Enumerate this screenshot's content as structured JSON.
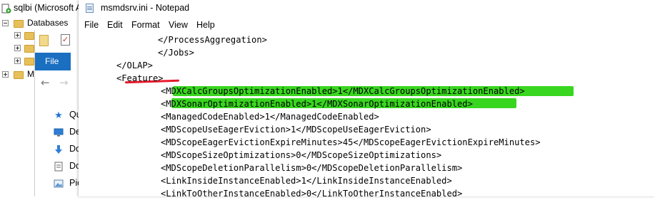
{
  "ssms": {
    "title": "sqlbi (Microsoft A",
    "tree": [
      {
        "label": "Databases",
        "expander": "minus"
      },
      {
        "label": "",
        "expander": "plus"
      },
      {
        "label": "",
        "expander": "plus"
      },
      {
        "label": "",
        "expander": "plus"
      },
      {
        "label": "M",
        "expander": "plus"
      }
    ]
  },
  "explorer": {
    "file_tab": "File",
    "back_arrow": "←",
    "forward_arrow": "→",
    "sidebar": [
      {
        "label": "Quic",
        "icon": "star-icon"
      },
      {
        "label": "De",
        "icon": "desktop-icon"
      },
      {
        "label": "Do",
        "icon": "download-icon"
      },
      {
        "label": "Do",
        "icon": "documents-icon"
      },
      {
        "label": "Pic",
        "icon": "pictures-icon"
      }
    ]
  },
  "notepad": {
    "title": "msmdsrv.ini - Notepad",
    "menu": [
      "File",
      "Edit",
      "Format",
      "View",
      "Help"
    ],
    "lines": [
      "    </ProcessAggregation>",
      "  </Jobs>",
      "</OLAP>",
      "<Feature>",
      "  <MDXCalcGroupsOptimizationEnabled>1</MDXCalcGroupsOptimizationEnabled>",
      "  <MDXSonarOptimizationEnabled>1</MDXSonarOptimizationEnabled>",
      "  <ManagedCodeEnabled>1</ManagedCodeEnabled>",
      "  <MDScopeUseEagerEviction>1</MDScopeUseEagerEviction>",
      "  <MDScopeEagerEvictionExpireMinutes>45</MDScopeEagerEvictionExpireMinutes>",
      "  <MDScopeSizeOptimizations>0</MDScopeSizeOptimizations>",
      "  <MDScopeDeletionParallelism>0</MDScopeDeletionParallelism>",
      "  <LinkInsideInstanceEnabled>1</LinkInsideInstanceEnabled>",
      "  <LinkToOtherInstanceEnabled>0</LinkToOtherInstanceEnabled>"
    ]
  },
  "colors": {
    "highlight": "#39d61f",
    "annotation_underline": "#e8192c",
    "file_tab": "#1a6fc1"
  }
}
